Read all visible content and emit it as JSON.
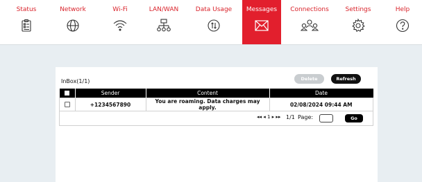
{
  "nav": {
    "items": [
      {
        "label": "Status",
        "icon": "clipboard-icon"
      },
      {
        "label": "Network",
        "icon": "globe-icon"
      },
      {
        "label": "Wi-Fi",
        "icon": "wifi-icon"
      },
      {
        "label": "LAN/WAN",
        "icon": "network-tree-icon"
      },
      {
        "label": "Data Usage",
        "icon": "data-usage-icon"
      },
      {
        "label": "Messages",
        "icon": "envelope-icon",
        "active": true
      },
      {
        "label": "Connections",
        "icon": "users-icon"
      },
      {
        "label": "Settings",
        "icon": "gear-icon"
      },
      {
        "label": "Help",
        "icon": "question-icon"
      }
    ]
  },
  "inbox": {
    "title": "InBox(1/1)",
    "delete_label": "Delete",
    "refresh_label": "Refresh",
    "columns": {
      "sender": "Sender",
      "content": "Content",
      "date": "Date"
    },
    "rows": [
      {
        "sender": "+1234567890",
        "content": "You are roaming. Data charges may apply.",
        "date": "02/08/2024 09:44 AM"
      }
    ]
  },
  "pager": {
    "arrows": "◂◂ ◂ 1 ▸ ▸▸",
    "current": "1",
    "pages": "1/1",
    "page_label": "Page:",
    "go_label": "Go"
  },
  "colors": {
    "accent": "#e21f2d",
    "accent_text": "#d9222a",
    "background": "#e8eef2"
  }
}
